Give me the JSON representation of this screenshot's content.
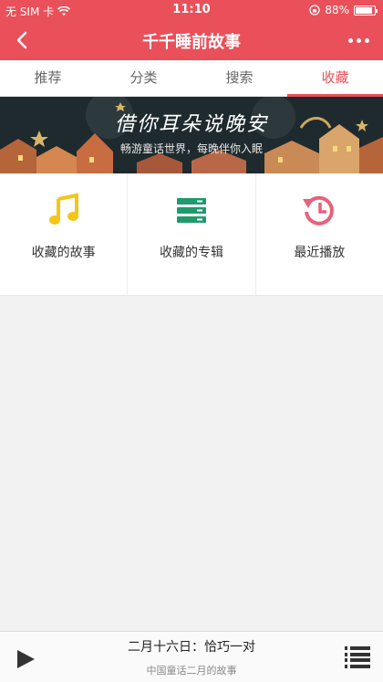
{
  "status_bar": {
    "carrier": "无 SIM 卡",
    "time": "11:10",
    "battery": "88%",
    "battery_level": 0.88
  },
  "nav": {
    "title": "千千睡前故事"
  },
  "tabs": [
    {
      "label": "推荐",
      "active": false
    },
    {
      "label": "分类",
      "active": false
    },
    {
      "label": "搜索",
      "active": false
    },
    {
      "label": "收藏",
      "active": true
    }
  ],
  "banner": {
    "title": "借你耳朵说晚安",
    "subtitle": "畅游童话世界，每晚伴你入眠"
  },
  "grid": [
    {
      "label": "收藏的故事",
      "icon": "music-note-icon",
      "color": "#f5c518"
    },
    {
      "label": "收藏的专辑",
      "icon": "album-stack-icon",
      "color": "#1e9a6c"
    },
    {
      "label": "最近播放",
      "icon": "history-icon",
      "color": "#e9607a"
    }
  ],
  "player": {
    "title": "二月十六日：恰巧一对",
    "subtitle": "中国童话二月的故事"
  },
  "colors": {
    "accent": "#e9505a",
    "banner_bg": "#1f2a2e"
  }
}
